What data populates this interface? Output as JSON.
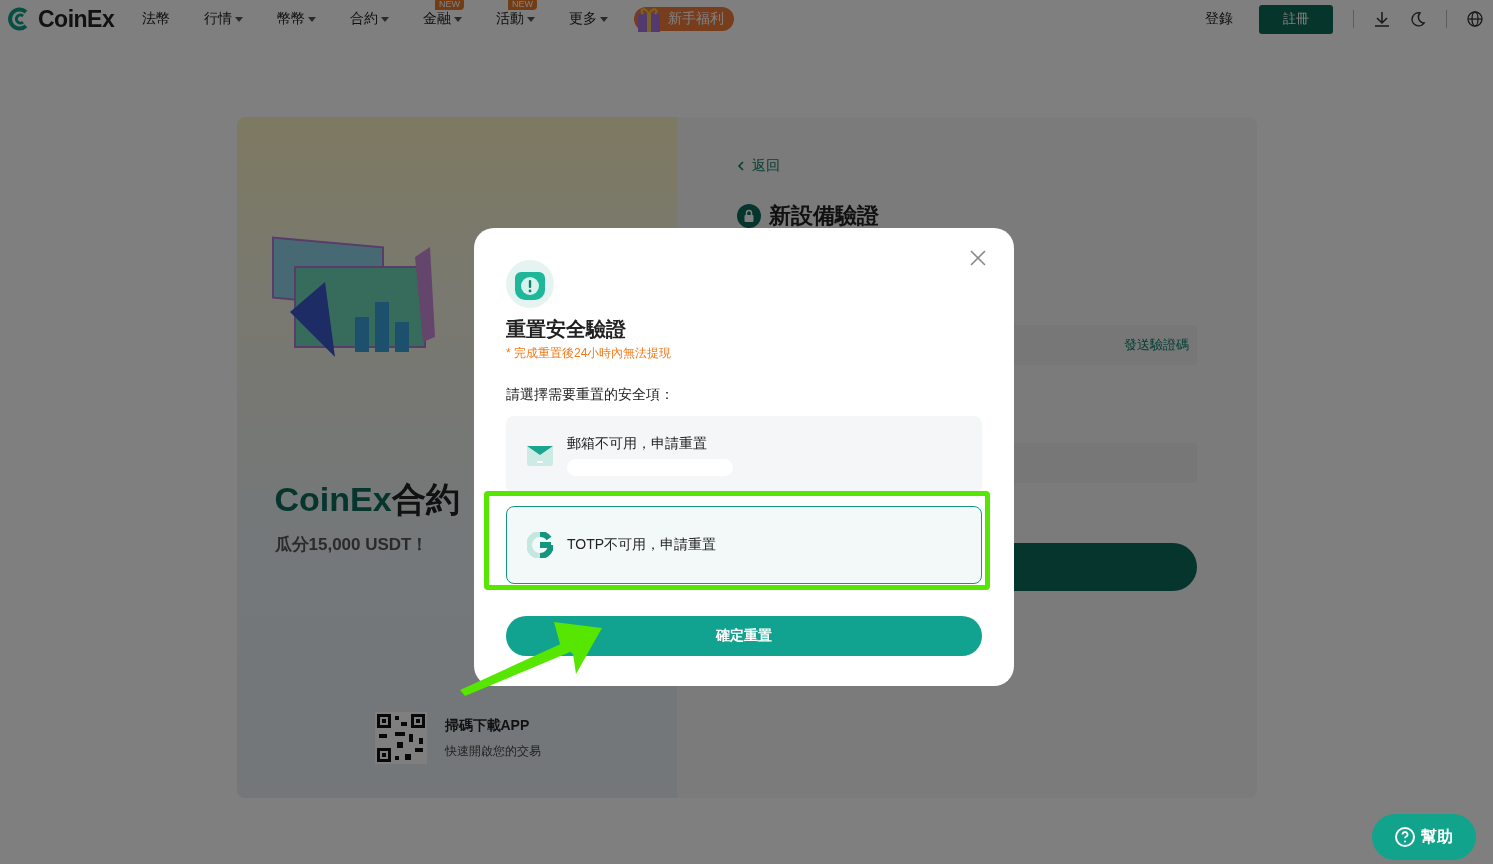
{
  "header": {
    "logo": "CoinEx",
    "nav": [
      {
        "label": "法幣",
        "caret": false
      },
      {
        "label": "行情",
        "caret": true
      },
      {
        "label": "幣幣",
        "caret": true
      },
      {
        "label": "合約",
        "caret": true
      },
      {
        "label": "金融",
        "caret": true,
        "badge": "NEW"
      },
      {
        "label": "活動",
        "caret": true,
        "badge": "NEW"
      },
      {
        "label": "更多",
        "caret": true
      }
    ],
    "promo": "新手福利",
    "login": "登錄",
    "register": "註冊"
  },
  "promo_panel": {
    "title_brand": "CoinEx",
    "title_rest": "合約",
    "subtitle": "瓜分15,000 USDT！",
    "qr_title": "掃碼下載APP",
    "qr_subtitle": "快速開啟您的交易"
  },
  "verify_panel": {
    "back": "返回",
    "title": "新設備驗證",
    "send_code": "發送驗證碼"
  },
  "dialog": {
    "title": "重置安全驗證",
    "warning": "* 完成重置後24小時內無法提現",
    "prompt": "請選擇需要重置的安全項：",
    "options": [
      {
        "kind": "email",
        "label": "郵箱不可用，申請重置",
        "selected": false
      },
      {
        "kind": "totp",
        "label": "TOTP不可用，申請重置",
        "selected": true
      }
    ],
    "confirm": "確定重置"
  },
  "help": "幫助"
}
